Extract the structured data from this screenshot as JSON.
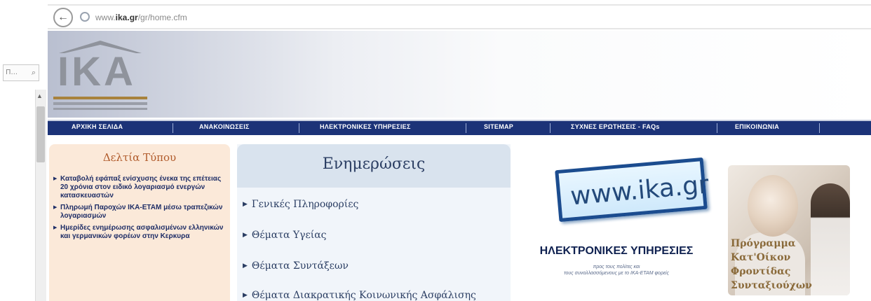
{
  "browser": {
    "url_prefix": "www.",
    "url_domain": "ika.gr",
    "url_path": "/gr/home.cfm",
    "sidebar_search": "Π..."
  },
  "logo": {
    "text": "IKA"
  },
  "nav": {
    "items": [
      {
        "label": "ΑΡΧΙΚΗ ΣΕΛΙΔΑ"
      },
      {
        "label": "ΑΝΑΚΟΙΝΩΣΕΙΣ"
      },
      {
        "label": "ΗΛΕΚΤΡΟΝΙΚΕΣ ΥΠΗΡΕΣΙΕΣ"
      },
      {
        "label": "SITEMAP"
      },
      {
        "label": "ΣΥΧΝΕΣ ΕΡΩΤΗΣΕΙΣ - FAQs"
      },
      {
        "label": "ΕΠΙΚΟΙΝΩΝΙΑ"
      }
    ]
  },
  "press": {
    "title": "Δελτία Τύπου",
    "items": [
      "Καταβολή εφάπαξ ενίσχυσης ένεκα της επέτειας 20 χρόνια στον ειδικό λογαριασμό ενεργών κατασκευαστών",
      "Πληρωμή Παροχών ΙΚΑ-ΕΤΑΜ μέσω τραπεζικών λογαριασμών",
      "Ημερίδες ενημέρωσης ασφαλισμένων ελληνικών και γερμανικών φορέων στην Κερκυρα"
    ]
  },
  "info": {
    "title": "Ενημερώσεις",
    "items": [
      "Γενικές Πληροφορίες",
      "Θέματα Υγείας",
      "Θέματα Συντάξεων",
      "Θέματα Διακρατικής Κοινωνικής Ασφάλισης"
    ]
  },
  "promo": {
    "www": "www.ika.gr",
    "title": "ΗΛΕΚΤΡΟΝΙΚΕΣ ΥΠΗΡΕΣΙΕΣ",
    "sub1": "προς τους πολίτες και",
    "sub2": "τους συναλλασσόμενους με το ΙΚΑ-ΕΤΑΜ φορείς"
  },
  "care": {
    "line1": "Πρόγραμμα",
    "line2": "Κατ'Οίκον",
    "line3": "Φροντίδας",
    "line4": "Συνταξιούχων"
  },
  "colors": {
    "nav_bg": "#1c3378",
    "press_bg": "#fbe9d9",
    "info_bg": "#f1f5fa",
    "accent_dark_blue": "#0f2150"
  }
}
